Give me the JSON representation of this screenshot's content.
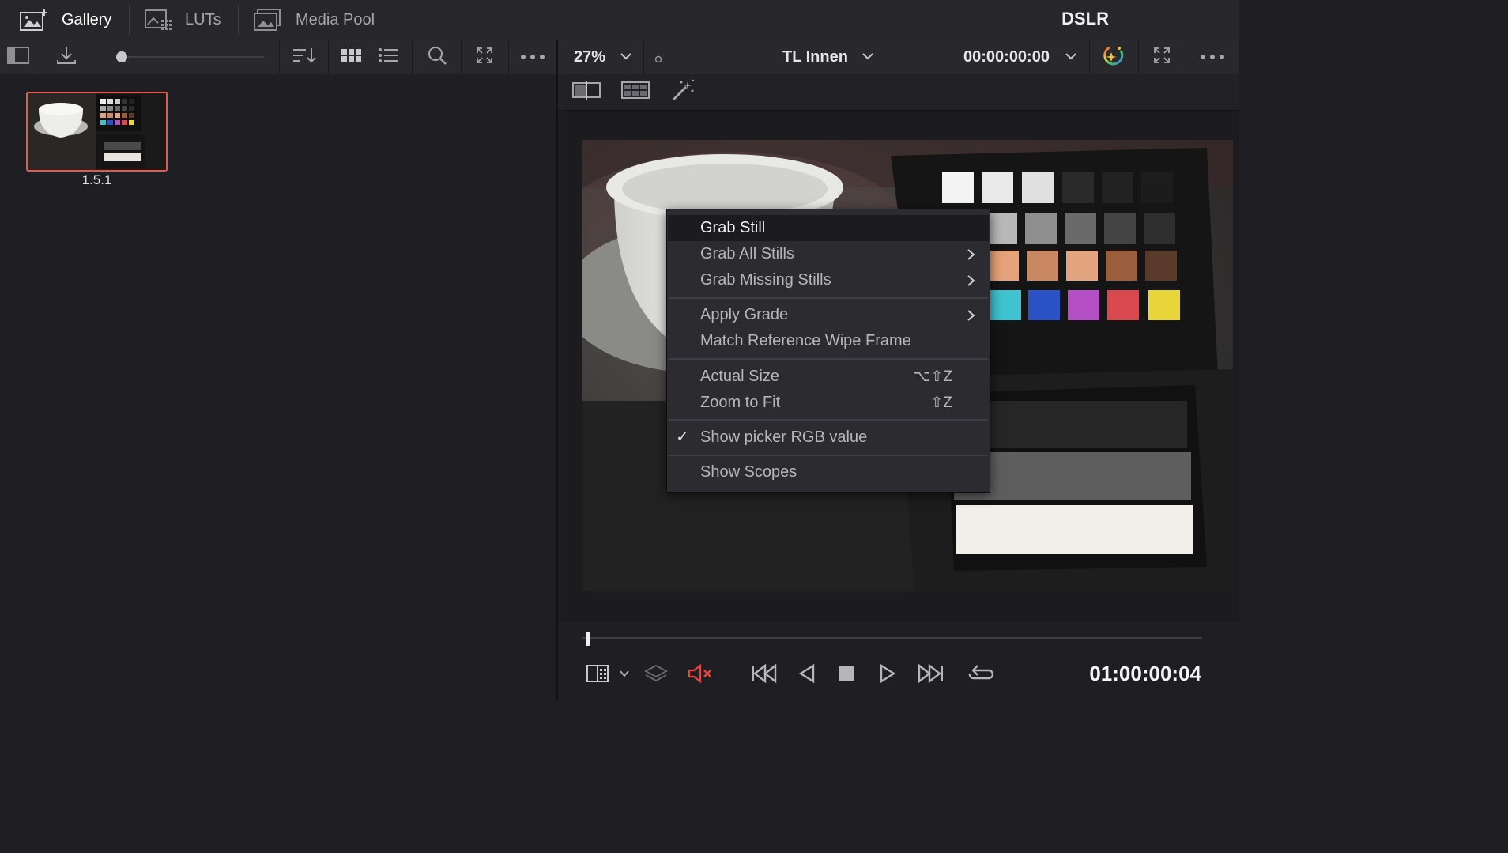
{
  "top_tabs": [
    {
      "label": "Gallery",
      "icon": "gallery-icon",
      "active": true
    },
    {
      "label": "LUTs",
      "icon": "luts-icon",
      "active": false
    },
    {
      "label": "Media Pool",
      "icon": "media-pool-icon",
      "active": false
    }
  ],
  "project_title": "DSLR",
  "gallery": {
    "stills": [
      {
        "label": "1.5.1",
        "selected": true
      }
    ]
  },
  "viewer": {
    "zoom": "27%",
    "clip_name": "TL Innen",
    "timecode": "00:00:00:00",
    "playhead_timecode": "01:00:00:04"
  },
  "context_menu": {
    "items": [
      {
        "label": "Grab Still",
        "highlighted": true
      },
      {
        "label": "Grab All Stills",
        "submenu": true
      },
      {
        "label": "Grab Missing Stills",
        "submenu": true
      },
      {
        "label": "Apply Grade",
        "submenu": true
      },
      {
        "label": "Match Reference Wipe Frame"
      },
      {
        "label": "Actual Size",
        "shortcut": "⌥⇧Z"
      },
      {
        "label": "Zoom to Fit",
        "shortcut": "⇧Z"
      },
      {
        "label": "Show picker RGB value",
        "checked": true
      },
      {
        "label": "Show Scopes"
      }
    ]
  },
  "colors": {
    "selection_border": "#e8584c",
    "mute_icon": "#e8453c",
    "background": "#1f1f23"
  }
}
